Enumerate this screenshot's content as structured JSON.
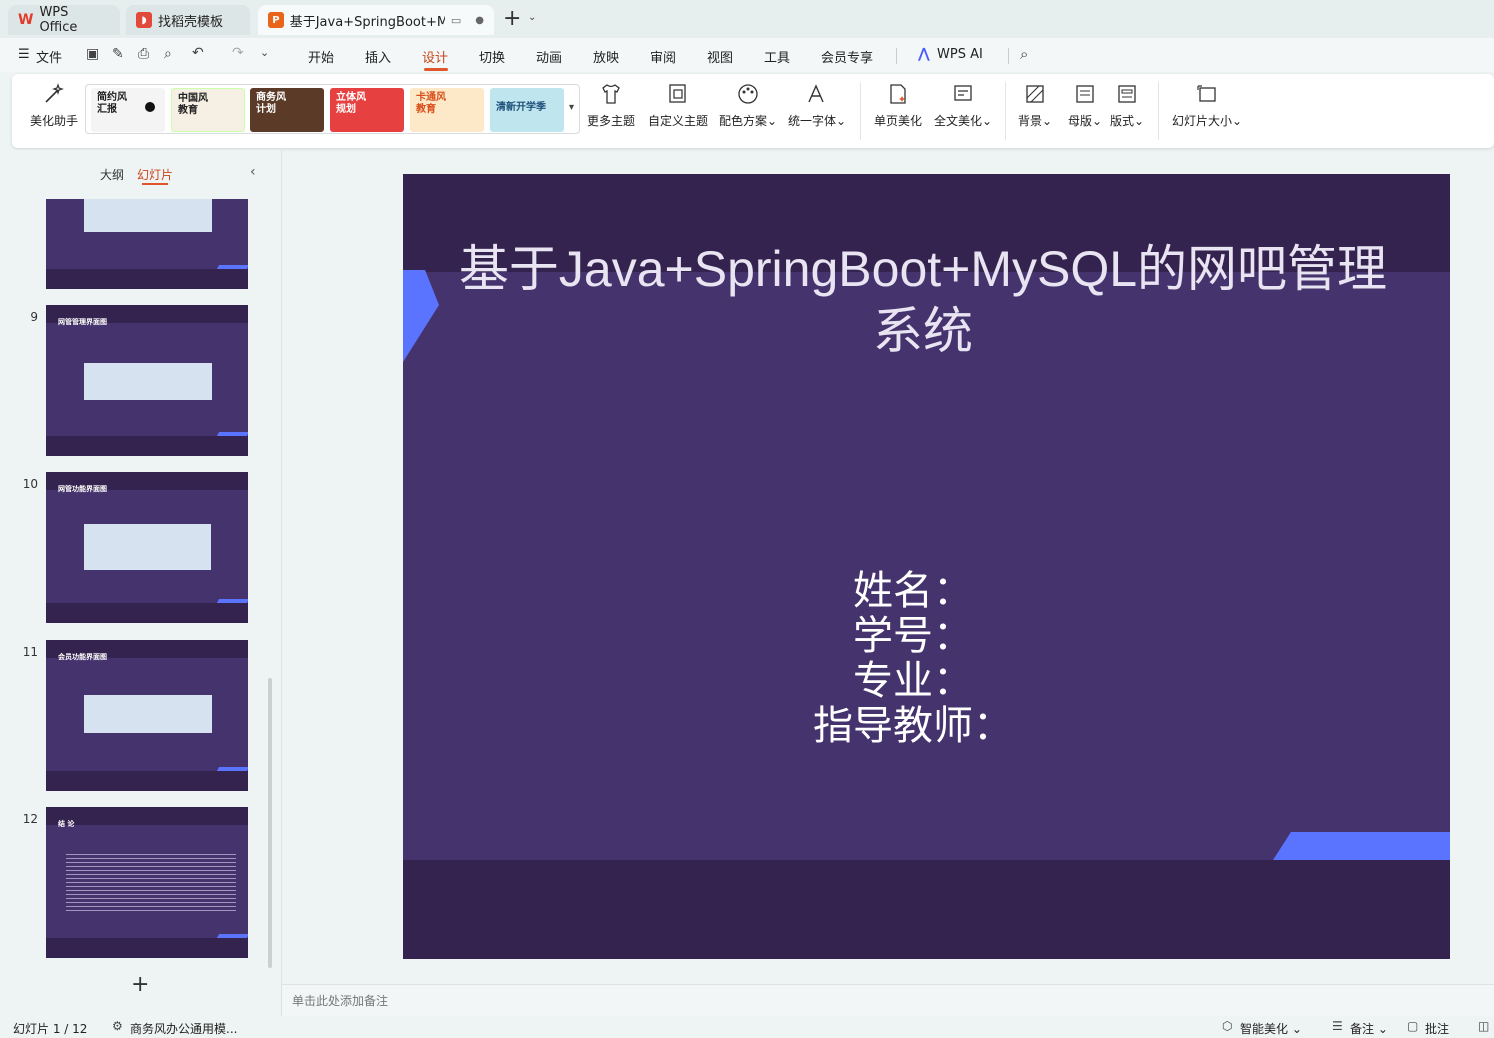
{
  "tabs": [
    {
      "label": "WPS Office",
      "icon": "wps-logo-icon"
    },
    {
      "label": "找稻壳模板",
      "icon": "docer-icon"
    },
    {
      "label": "基于Java+SpringBoot+MyS",
      "icon": "ppt-file-icon"
    }
  ],
  "new_tab": "+",
  "menu": {
    "file": "文件",
    "items": [
      "开始",
      "插入",
      "设计",
      "切换",
      "动画",
      "放映",
      "审阅",
      "视图",
      "工具",
      "会员专享"
    ],
    "active": "设计",
    "wps_ai": "WPS AI"
  },
  "ribbon": {
    "beautify": "美化助手",
    "templates": [
      {
        "label": "简约风\n汇报",
        "bg": "#f4f4f4",
        "color": "#222"
      },
      {
        "label": "中国风\n教育",
        "bg": "#f6f0e4",
        "color": "#222"
      },
      {
        "label": "商务风\n计划",
        "bg": "#5b3a28",
        "color": "#fff"
      },
      {
        "label": "立体风\n规划",
        "bg": "#e64040",
        "color": "#fff"
      },
      {
        "label": "卡通风\n教育",
        "bg": "#fde9c8",
        "color": "#d94f1b"
      },
      {
        "label": "清新开学季",
        "bg": "#bfe6ef",
        "color": "#1d4f7a"
      }
    ],
    "buttons": [
      "更多主题",
      "自定义主题",
      "配色方案",
      "统一字体",
      "单页美化",
      "全文美化",
      "背景",
      "母版",
      "版式",
      "幻灯片大小"
    ]
  },
  "panel": {
    "outline": "大纲",
    "slides": "幻灯片",
    "add": "+",
    "thumbs": [
      {
        "num": "",
        "title": ""
      },
      {
        "num": "9",
        "title": "网管管理界面图"
      },
      {
        "num": "10",
        "title": "网管功能界面图"
      },
      {
        "num": "11",
        "title": "会员功能界面图"
      },
      {
        "num": "12",
        "title": "结 论"
      }
    ]
  },
  "slide": {
    "title": "基于Java+SpringBoot+MySQL的网吧管理系统",
    "lines": [
      "姓名：",
      "学号：",
      "专业：",
      "指导教师："
    ]
  },
  "notes_placeholder": "单击此处添加备注",
  "status": {
    "slide_count": "幻灯片 1 / 12",
    "template": "商务风办公通用模...",
    "smart": "智能美化",
    "notes": "备注",
    "comments": "批注"
  },
  "colors": {
    "slide_bg": "#45336d",
    "slide_band": "#35234f",
    "accent_blue": "#5b74ff",
    "active_menu": "#c8461d"
  }
}
